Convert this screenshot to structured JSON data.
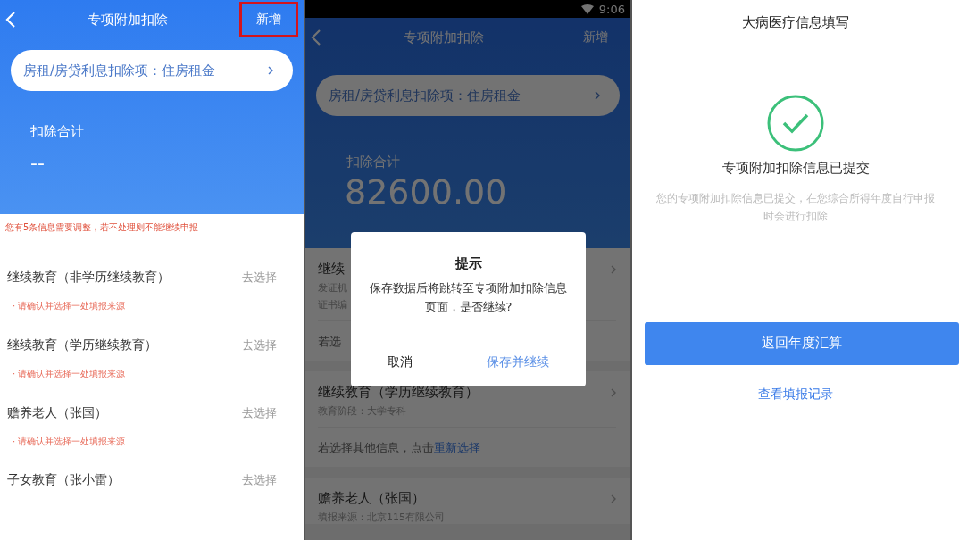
{
  "screen_list": {
    "header": {
      "title": "专项附加扣除",
      "action": {
        "label": "新增",
        "highlighted": true
      }
    },
    "pill": "房租/房贷利息扣除项：住房租金",
    "total_label": "扣除合计",
    "total_value": "--",
    "warning": "您有5条信息需要调整，若不处理则不能继续申报",
    "items": [
      {
        "title": "继续教育（非学历继续教育）",
        "action": "去选择",
        "hint": "· 请确认并选择一处填报来源"
      },
      {
        "title": "继续教育（学历继续教育）",
        "action": "去选择",
        "hint": "· 请确认并选择一处填报来源"
      },
      {
        "title": "赡养老人（张国）",
        "action": "去选择",
        "hint": "· 请确认并选择一处填报来源"
      },
      {
        "title": "子女教育（张小雷）",
        "action": "去选择"
      }
    ]
  },
  "screen_dialog": {
    "status_bar": {
      "time": "9:06"
    },
    "header": {
      "title": "专项附加扣除",
      "action": {
        "label": "新增",
        "highlighted": false
      }
    },
    "pill": "房租/房贷利息扣除项：住房租金",
    "total_label": "扣除合计",
    "total_value": "82600.00",
    "cards": [
      {
        "title": "继续",
        "lines": [
          "发证机",
          "证书编"
        ],
        "footer": "若选"
      },
      {
        "title": "继续教育（学历继续教育）",
        "lines": [
          "教育阶段：大学专科"
        ],
        "footer": "若选择其他信息，点击",
        "footer_link": "重新选择"
      },
      {
        "title": "赡养老人（张国）",
        "lines": [
          "填报来源：北京115有限公司"
        ]
      }
    ],
    "dialog": {
      "title": "提示",
      "message": "保存数据后将跳转至专项附加扣除信息页面，是否继续?",
      "buttons": [
        {
          "label": "取消",
          "primary": false
        },
        {
          "label": "保存并继续",
          "primary": true
        }
      ]
    }
  },
  "screen_submitted": {
    "title": "大病医疗信息填写",
    "status_title": "专项附加扣除信息已提交",
    "status_text": "您的专项附加扣除信息已提交，在您综合所得年度自行申报时会进行扣除",
    "button": "返回年度汇算",
    "link": "查看填报记录"
  }
}
